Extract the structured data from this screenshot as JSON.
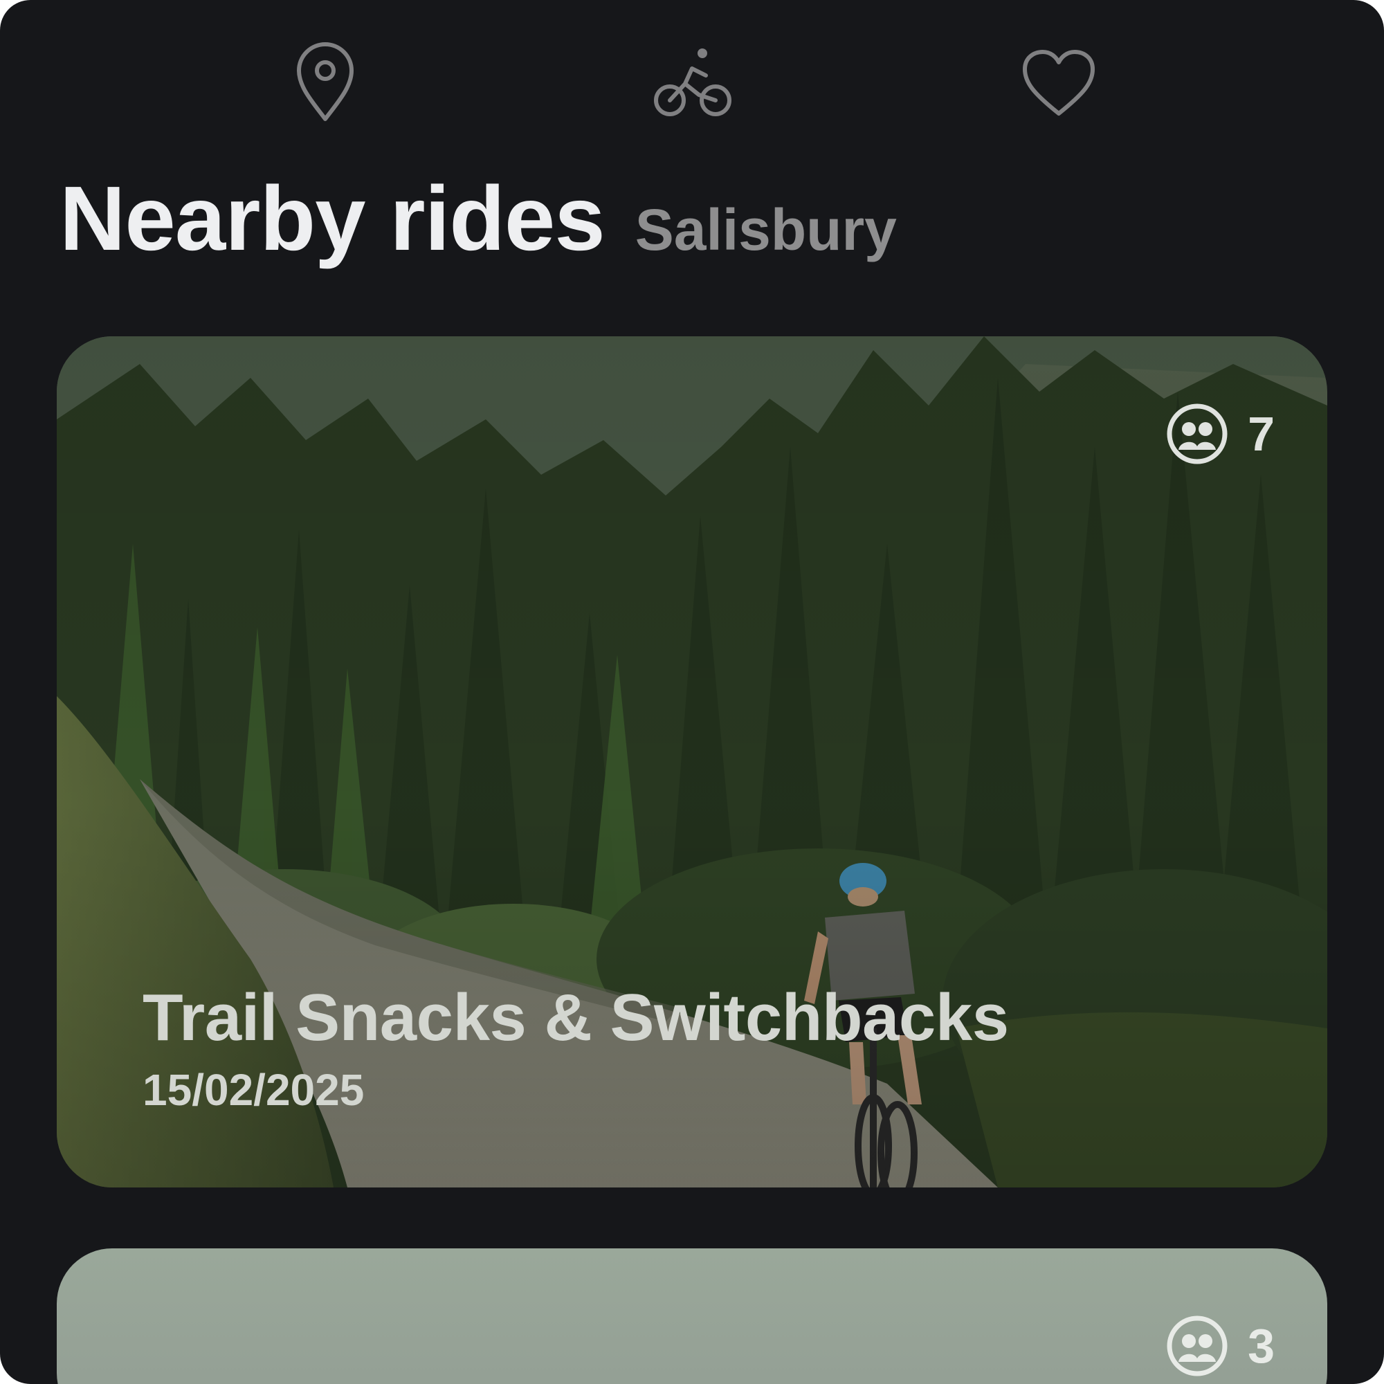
{
  "nav": {
    "items": [
      {
        "icon": "location-pin-icon",
        "label": "Location"
      },
      {
        "icon": "cyclist-icon",
        "label": "Rides"
      },
      {
        "icon": "heart-icon",
        "label": "Favourites"
      }
    ],
    "icon_color": "#808082"
  },
  "header": {
    "title": "Nearby rides",
    "location": "Salisbury"
  },
  "rides": [
    {
      "title": "Trail Snacks & Switchbacks",
      "date": "15/02/2025",
      "riders": "7",
      "riders_icon": "group-icon"
    },
    {
      "title": "",
      "date": "",
      "riders": "3",
      "riders_icon": "group-icon"
    }
  ],
  "colors": {
    "background": "#16171a",
    "title": "#eeeff1",
    "subtitle": "#8e8e8f",
    "card_text": "#d3d6d0"
  }
}
